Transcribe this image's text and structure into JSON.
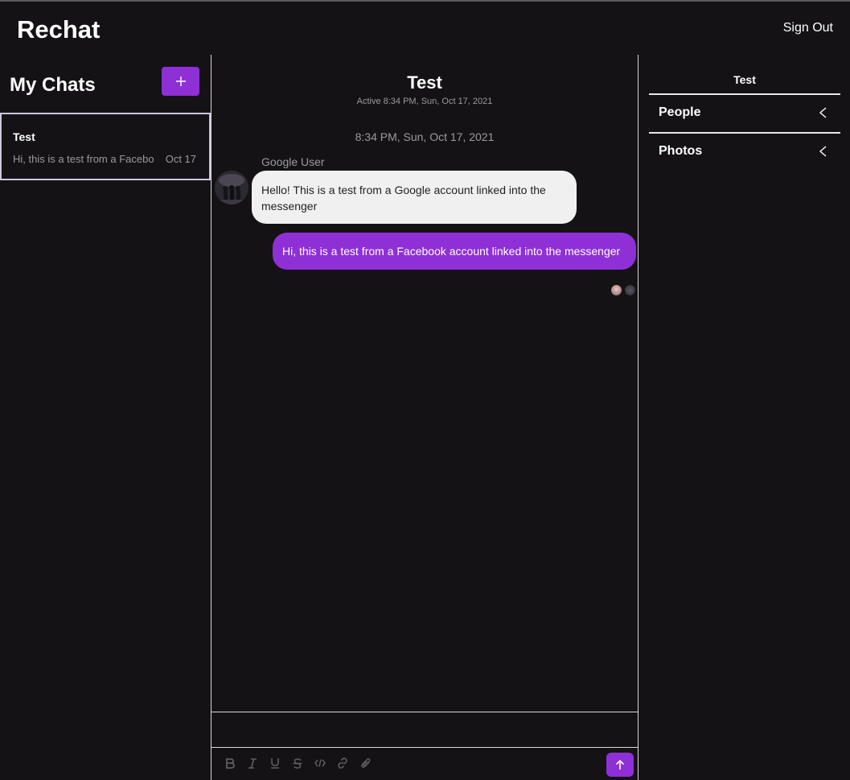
{
  "app": {
    "brand": "Rechat",
    "sign_out_label": "Sign Out"
  },
  "sidebar": {
    "title": "My Chats",
    "new_chat_icon": "plus-icon",
    "chats": [
      {
        "name": "Test",
        "preview": "Hi, this is a test from a Facebook account linked into the messenger",
        "date": "Oct 17"
      }
    ]
  },
  "chat": {
    "title": "Test",
    "active": "Active 8:34 PM, Sun, Oct 17, 2021",
    "timestamp": "8:34 PM, Sun, Oct 17, 2021",
    "messages": [
      {
        "sender": "Google User",
        "text": "Hello! This is a test from a Google account linked into the messenger",
        "direction": "incoming"
      },
      {
        "sender": "",
        "text": "Hi, this is a test from a Facebook account linked into the messenger",
        "direction": "outgoing"
      }
    ],
    "composer": {
      "tools": [
        "bold-icon",
        "italic-icon",
        "underline-icon",
        "strikethrough-icon",
        "code-icon",
        "link-icon",
        "attachment-icon"
      ],
      "send_icon": "arrow-up-icon"
    }
  },
  "settings": {
    "title": "Test",
    "sections": [
      {
        "label": "People"
      },
      {
        "label": "Photos"
      }
    ]
  },
  "colors": {
    "accent": "#8e30d6",
    "background": "#141215",
    "incoming_bubble": "#f0f0f0"
  }
}
